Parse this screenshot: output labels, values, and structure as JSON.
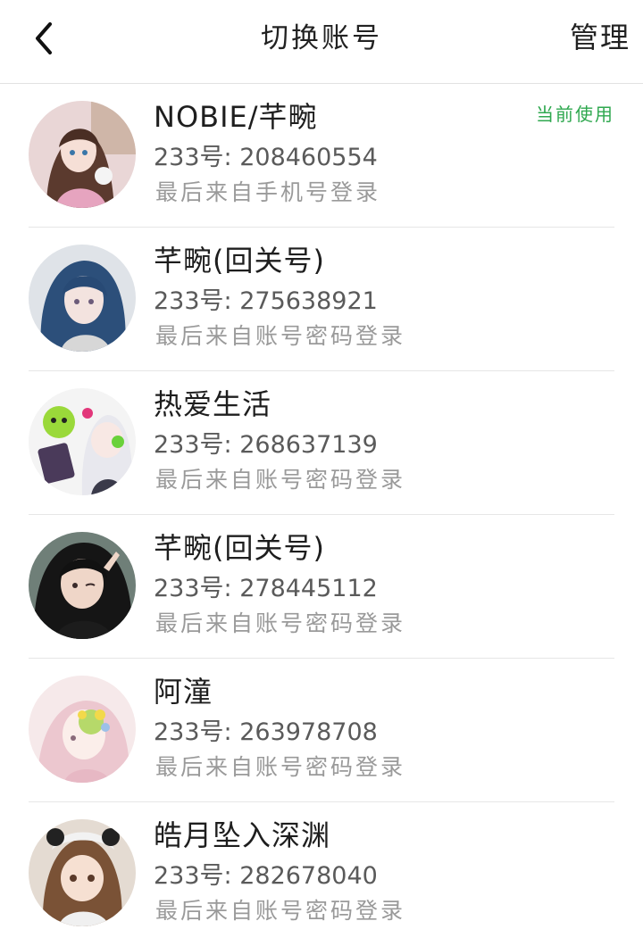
{
  "header": {
    "title": "切换账号",
    "manage_label": "管理",
    "back_icon": "chevron-left-icon"
  },
  "colors": {
    "current_badge": "#2fa84f",
    "source_text": "#9a9a9a",
    "divider": "#e6e6e6"
  },
  "accounts": [
    {
      "name": "NOBIE/芊畹",
      "uid_label": "233号: 208460554",
      "source": "最后来自手机号登录",
      "badge": "当前使用"
    },
    {
      "name": "芊畹(回关号)",
      "uid_label": "233号: 275638921",
      "source": "最后来自账号密码登录"
    },
    {
      "name": "热爱生活",
      "uid_label": "233号: 268637139",
      "source": "最后来自账号密码登录"
    },
    {
      "name": "芊畹(回关号)",
      "uid_label": "233号: 278445112",
      "source": "最后来自账号密码登录"
    },
    {
      "name": "阿潼",
      "uid_label": "233号: 263978708",
      "source": "最后来自账号密码登录"
    },
    {
      "name": "皓月坠入深渊",
      "uid_label": "233号: 282678040",
      "source": "最后来自账号密码登录"
    }
  ]
}
